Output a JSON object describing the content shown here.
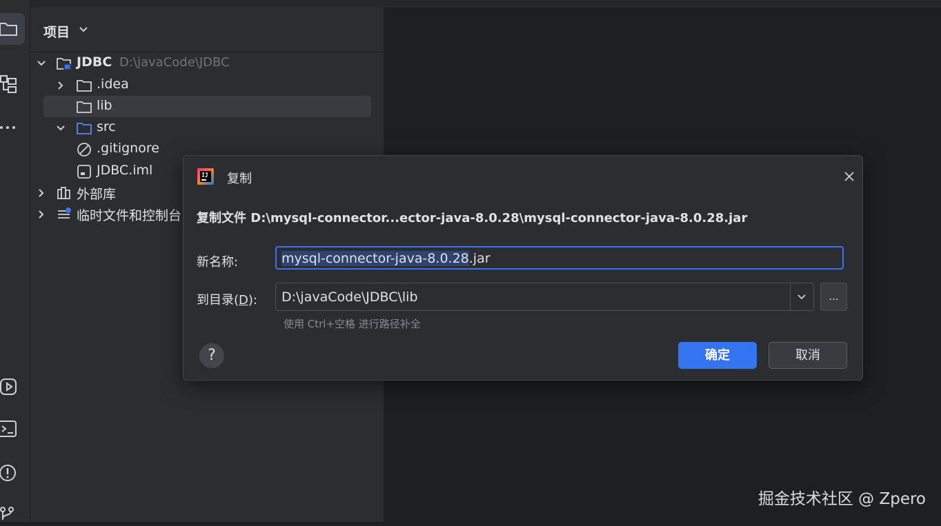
{
  "project_panel": {
    "title": "项目",
    "tree": [
      {
        "label": "JDBC",
        "path": "D:\\javaCode\\JDBC"
      },
      {
        "label": ".idea"
      },
      {
        "label": "lib"
      },
      {
        "label": "src"
      },
      {
        "label": ".gitignore"
      },
      {
        "label": "JDBC.iml"
      },
      {
        "label": "外部库"
      },
      {
        "label": "临时文件和控制台"
      }
    ]
  },
  "dialog": {
    "title": "复制",
    "heading": "复制文件 D:\\mysql-connector...ector-java-8.0.28\\mysql-connector-java-8.0.28.jar",
    "name_label": "新名称:",
    "name_value_selected": "mysql-connector-java-8.0.28",
    "name_value_ext": ".jar",
    "dir_label_before": "到目录(",
    "dir_label_key": "D",
    "dir_label_after": "):",
    "dir_value": "D:\\javaCode\\JDBC\\lib",
    "browse_label": "...",
    "hint": "使用 Ctrl+空格 进行路径补全",
    "help_label": "?",
    "ok_label": "确定",
    "cancel_label": "取消"
  },
  "watermark": "掘金技术社区 @ Zpero",
  "colors": {
    "accent": "#3574f0",
    "panel_bg": "#2b2d30",
    "editor_bg": "#1e1f22",
    "selection_bg": "#393b40",
    "text_selection": "#2e436e"
  }
}
